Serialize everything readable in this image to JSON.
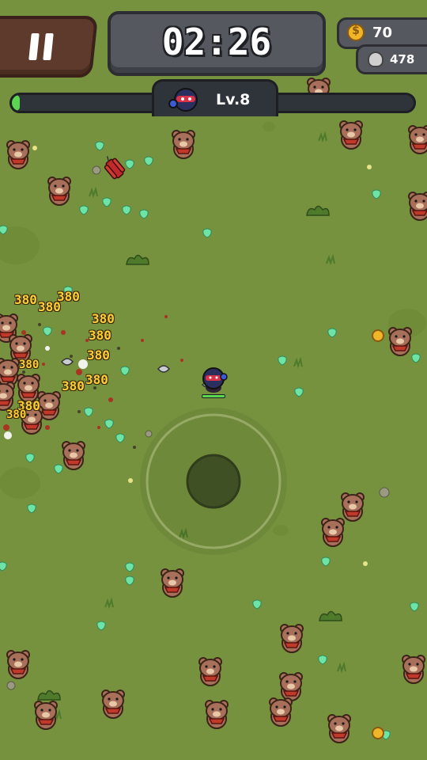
{
  "hud": {
    "timer": "02:26",
    "coins": "70",
    "kills": "478",
    "level": "Lv.8",
    "xp_progress": 0.02,
    "pause_icon": "pause-icon",
    "coin_icon": "coin-icon",
    "skull_icon": "skull-icon"
  },
  "damage_label": "380",
  "colors": {
    "grass": "#76923f",
    "xp_fill": "#5ad650",
    "gem": "#6fe3a6",
    "damage_text": "#ffcf3a",
    "bear_fur": "#a8705a",
    "scarf": "#c0392b"
  }
}
